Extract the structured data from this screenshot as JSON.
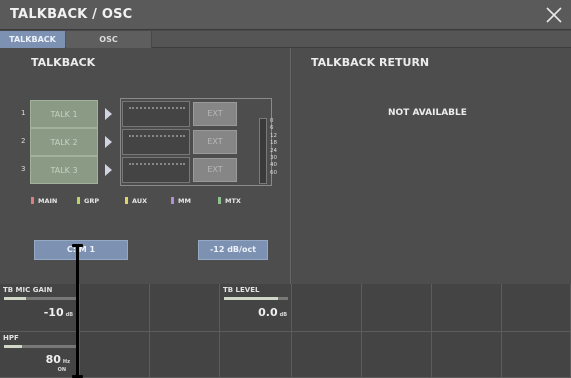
{
  "window": {
    "title": "TALKBACK / OSC"
  },
  "tabs": [
    {
      "label": "TALKBACK",
      "active": true
    },
    {
      "label": "OSC",
      "active": false
    }
  ],
  "talkback": {
    "title": "TALKBACK",
    "rows": [
      {
        "num": "1",
        "label": "TALK 1",
        "ext": "EXT"
      },
      {
        "num": "2",
        "label": "TALK 2",
        "ext": "EXT"
      },
      {
        "num": "3",
        "label": "TALK 3",
        "ext": "EXT"
      }
    ],
    "meter_scale": [
      "0",
      "6",
      "12",
      "18",
      "24",
      "30",
      "40",
      "60"
    ],
    "legend": [
      {
        "label": "MAIN",
        "color": "#d98080"
      },
      {
        "label": "GRP",
        "color": "#b8d36a"
      },
      {
        "label": "AUX",
        "color": "#e0d36a"
      },
      {
        "label": "MM",
        "color": "#b58cd8"
      },
      {
        "label": "MTX",
        "color": "#8fc08f"
      }
    ],
    "input_select": "C:  M 1",
    "hpf_slope": "-12 dB/oct"
  },
  "talkback_return": {
    "title": "TALKBACK RETURN",
    "status": "NOT AVAILABLE"
  },
  "knobs": {
    "tb_mic_gain": {
      "label": "TB MIC GAIN",
      "value": "-10",
      "unit": "dB",
      "level": 0.3
    },
    "tb_level": {
      "label": "TB LEVEL",
      "value": "0.0",
      "unit": "dB",
      "level": 0.85
    },
    "hpf": {
      "label": "HPF",
      "value": "80",
      "unit": "Hz",
      "state": "ON",
      "level": 0.25
    }
  },
  "colors": {
    "accent_blue": "#7d92b3",
    "talk_green": "#8a9a85"
  }
}
